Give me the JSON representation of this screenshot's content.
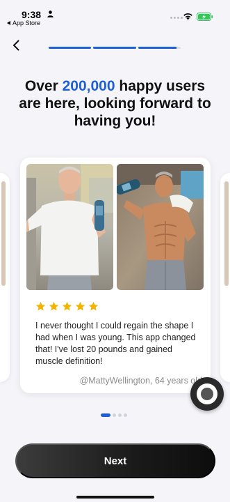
{
  "status_bar": {
    "time": "9:38",
    "back_app_label": "App Store",
    "battery_color": "#34c759"
  },
  "nav": {
    "back_icon": "chevron-left-icon",
    "progress_segments": [
      1,
      1,
      0.9
    ],
    "progress_color": "#1e5fd6"
  },
  "headline": {
    "part1": "Over ",
    "highlight": "200,000",
    "part2": " happy users are here, looking forward to having you!",
    "accent_color": "#1e5fd6"
  },
  "testimonial": {
    "rating": 5,
    "star_color": "#f5b301",
    "review": "I never thought I could regain the shape I had when I was young. This app changed that! I've lost 20 pounds and gained muscle definition!",
    "author": "@MattyWellington, 64 years old",
    "photos": [
      "before-photo",
      "after-photo"
    ]
  },
  "carousel": {
    "page_count": 4,
    "active_page": 0
  },
  "footer": {
    "next_label": "Next"
  }
}
